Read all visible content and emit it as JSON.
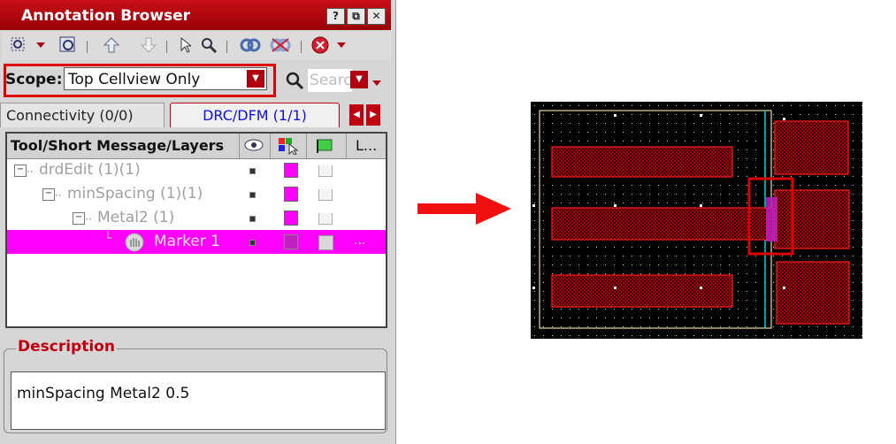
{
  "window": {
    "title": "Annotation Browser",
    "buttons": [
      "?",
      "⧉",
      "✕"
    ]
  },
  "toolbar": {
    "icons": [
      "zoom-select-icon",
      "zoom-fit-icon",
      "arrow-up-icon",
      "arrow-down-icon",
      "pointer-icon",
      "magnifier-icon",
      "link-icon",
      "unlink-icon",
      "close-circle-icon"
    ]
  },
  "scope": {
    "label": "Scope:",
    "value": "Top Cellview Only"
  },
  "search": {
    "placeholder": "Search"
  },
  "tabs": [
    {
      "label": "Connectivity (0/0)"
    },
    {
      "label": "DRC/DFM (1/1)"
    }
  ],
  "tree": {
    "header": {
      "col1": "Tool/Short Message/Layers",
      "col4": "L..."
    },
    "rows": [
      {
        "label": "drdEdit (1)(1)"
      },
      {
        "label": "minSpacing (1)(1)"
      },
      {
        "label": "Metal2 (1)"
      },
      {
        "label": "Marker 1",
        "extra": "..."
      }
    ],
    "swatch_color": "#ff00ff"
  },
  "description": {
    "title": "Description",
    "text": "minSpacing Metal2 0.5"
  },
  "colors": {
    "accent": "#c00010",
    "highlight": "#ff00ff",
    "marker_box": "#e00000",
    "cyan_line": "#00d0d0"
  }
}
